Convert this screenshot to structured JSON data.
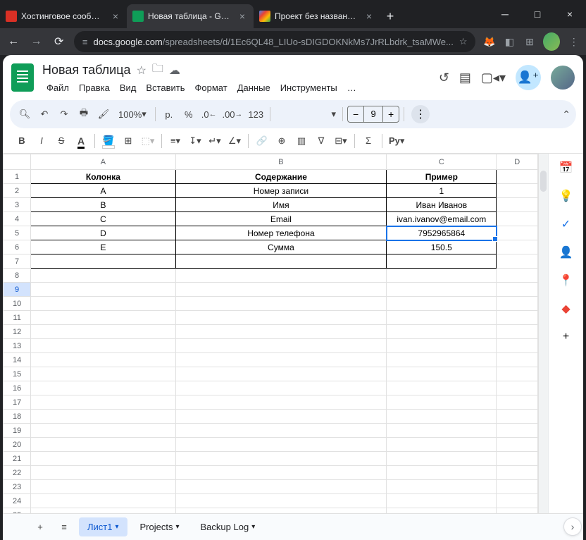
{
  "browser": {
    "tabs": [
      {
        "title": "Хостинговое сообщество"
      },
      {
        "title": "Новая таблица - Google Т"
      },
      {
        "title": "Проект без названия - Ре"
      }
    ],
    "url_host": "docs.google.com",
    "url_path": "/spreadsheets/d/1Ec6QL48_LIUo-sDIGDOKNkMs7JrRLbdrk_tsaMWe..."
  },
  "doc": {
    "title": "Новая таблица",
    "menus": [
      "Файл",
      "Правка",
      "Вид",
      "Вставить",
      "Формат",
      "Данные",
      "Инструменты",
      "…"
    ]
  },
  "toolbar": {
    "zoom": "100%",
    "currency": "р.",
    "percent": "%",
    "dec_dec": ".0",
    "dec_inc": ".00",
    "numfmt": "123",
    "fontsize": "9",
    "python": "Py"
  },
  "grid": {
    "cols": [
      "A",
      "B",
      "C",
      "D"
    ],
    "selected_row_hdr": "9",
    "table": {
      "headers": [
        "Колонка",
        "Содержание",
        "Пример"
      ],
      "rows": [
        [
          "A",
          "Номер записи",
          "1"
        ],
        [
          "B",
          "Имя",
          "Иван Иванов"
        ],
        [
          "C",
          "Email",
          "ivan.ivanov@email.com"
        ],
        [
          "D",
          "Номер телефона",
          "7952965864"
        ],
        [
          "E",
          "Сумма",
          "150.5"
        ]
      ]
    }
  },
  "sheets": [
    {
      "name": "Лист1",
      "active": true
    },
    {
      "name": "Projects",
      "active": false
    },
    {
      "name": "Backup Log",
      "active": false
    }
  ]
}
